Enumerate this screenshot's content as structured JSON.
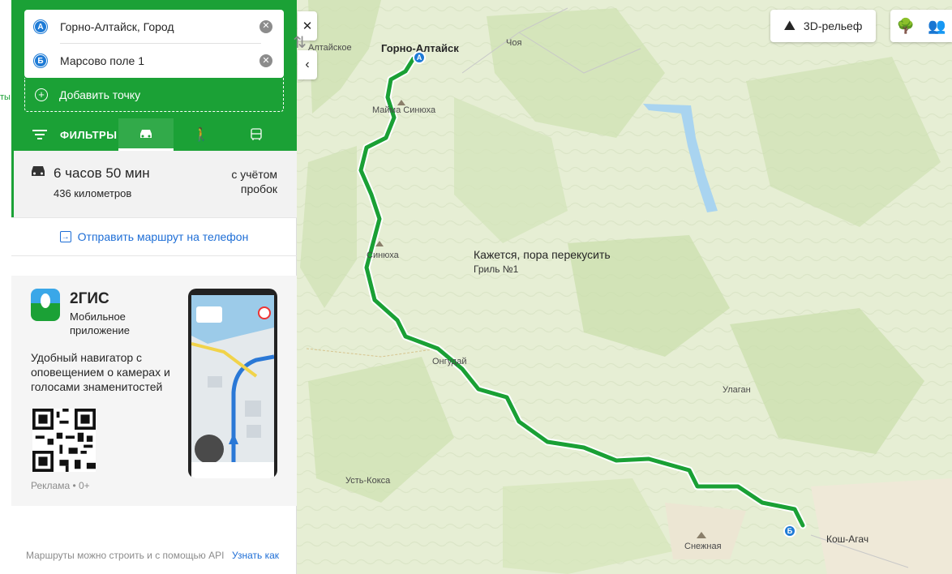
{
  "sidebar_strip": {
    "label": "ты"
  },
  "route": {
    "point_a": {
      "marker": "А",
      "value": "Горно-Алтайск, Город"
    },
    "point_b": {
      "marker": "Б",
      "value": "Марсово поле 1"
    },
    "add_point_label": "Добавить точку",
    "filters_label": "ФИЛЬТРЫ",
    "transport_modes": [
      {
        "name": "car",
        "icon": "car-icon",
        "active": true
      },
      {
        "name": "walk",
        "icon": "pedestrian-icon",
        "active": false
      },
      {
        "name": "public",
        "icon": "bus-icon",
        "active": false
      }
    ]
  },
  "summary": {
    "duration": "6 часов 50 мин",
    "distance": "436 километров",
    "traffic": "с учётом пробок"
  },
  "send_to_phone": "Отправить маршрут на телефон",
  "ad": {
    "app_name": "2ГИС",
    "app_subtitle": "Мобильное приложение",
    "text": "Удобный навигатор с оповещением о камерах и голосами знаменитостей",
    "label": "Реклама • 0+"
  },
  "footer": {
    "text": "Маршруты можно строить и с помощью API",
    "link": "Узнать как"
  },
  "map_controls": {
    "relief_label": "3D-рельеф"
  },
  "map_labels": {
    "gorno_altaysk": "Горно-Алтайск",
    "altayskoe": "Алтайское",
    "choya": "Чоя",
    "mayma_sinyukha": "Майма Синюха",
    "sinyukha": "Синюха",
    "ongudai": "Онгудай",
    "ulagan": "Улаган",
    "ust_koksa": "Усть-Кокса",
    "snezhnaya": "Снежная",
    "kosh_agach": "Кош-Агач"
  },
  "poi": {
    "title": "Кажется, пора перекусить",
    "subtitle": "Гриль №1"
  },
  "colors": {
    "brand_green": "#1ba136",
    "route_green": "#1aa035",
    "link_blue": "#1e6ed6",
    "marker_blue": "#1e7bd6"
  }
}
